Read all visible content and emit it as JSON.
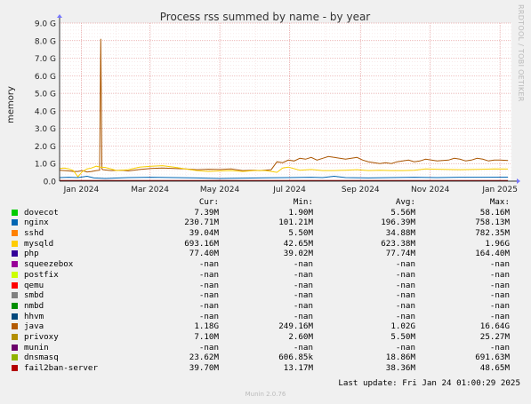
{
  "chart_data": {
    "type": "line",
    "title": "Process rss summed by name - by year",
    "ylabel": "memory",
    "xlabel": "",
    "side_label": "RRDTOOL / TOBI OETIKER",
    "yticks": [
      "0.0",
      "1.0 G",
      "2.0 G",
      "3.0 G",
      "4.0 G",
      "5.0 G",
      "6.0 G",
      "7.0 G",
      "8.0 G",
      "9.0 G"
    ],
    "ylim": [
      0,
      9.0
    ],
    "xticks": [
      "Jan 2024",
      "Mar 2024",
      "May 2024",
      "Jul 2024",
      "Sep 2024",
      "Nov 2024",
      "Jan 2025"
    ],
    "xtick_days": [
      19,
      79,
      140,
      201,
      263,
      324,
      385
    ],
    "xlim_days": [
      0,
      395
    ],
    "grid": true,
    "series": [
      {
        "name": "java",
        "color": "#aa5500",
        "points": [
          [
            0,
            0.62
          ],
          [
            4,
            0.6
          ],
          [
            8,
            0.58
          ],
          [
            12,
            0.55
          ],
          [
            16,
            0.55
          ],
          [
            20,
            0.6
          ],
          [
            24,
            0.52
          ],
          [
            28,
            0.55
          ],
          [
            32,
            0.6
          ],
          [
            35,
            0.62
          ],
          [
            36,
            8.1
          ],
          [
            37,
            0.7
          ],
          [
            38,
            0.65
          ],
          [
            45,
            0.6
          ],
          [
            55,
            0.62
          ],
          [
            60,
            0.58
          ],
          [
            70,
            0.66
          ],
          [
            80,
            0.72
          ],
          [
            90,
            0.75
          ],
          [
            100,
            0.72
          ],
          [
            110,
            0.7
          ],
          [
            120,
            0.65
          ],
          [
            130,
            0.68
          ],
          [
            140,
            0.66
          ],
          [
            150,
            0.7
          ],
          [
            160,
            0.6
          ],
          [
            170,
            0.62
          ],
          [
            175,
            0.6
          ],
          [
            185,
            0.65
          ],
          [
            190,
            1.1
          ],
          [
            195,
            1.05
          ],
          [
            200,
            1.2
          ],
          [
            205,
            1.15
          ],
          [
            210,
            1.3
          ],
          [
            215,
            1.25
          ],
          [
            220,
            1.35
          ],
          [
            225,
            1.2
          ],
          [
            230,
            1.3
          ],
          [
            235,
            1.4
          ],
          [
            240,
            1.35
          ],
          [
            245,
            1.3
          ],
          [
            250,
            1.25
          ],
          [
            255,
            1.3
          ],
          [
            260,
            1.35
          ],
          [
            265,
            1.2
          ],
          [
            270,
            1.1
          ],
          [
            275,
            1.05
          ],
          [
            280,
            1.0
          ],
          [
            285,
            1.05
          ],
          [
            290,
            1.0
          ],
          [
            295,
            1.1
          ],
          [
            300,
            1.15
          ],
          [
            305,
            1.2
          ],
          [
            310,
            1.1
          ],
          [
            315,
            1.15
          ],
          [
            320,
            1.25
          ],
          [
            325,
            1.2
          ],
          [
            330,
            1.15
          ],
          [
            340,
            1.2
          ],
          [
            345,
            1.3
          ],
          [
            350,
            1.25
          ],
          [
            355,
            1.15
          ],
          [
            360,
            1.2
          ],
          [
            365,
            1.3
          ],
          [
            370,
            1.25
          ],
          [
            375,
            1.15
          ],
          [
            380,
            1.2
          ],
          [
            385,
            1.2
          ],
          [
            392,
            1.18
          ]
        ]
      },
      {
        "name": "mysqld",
        "color": "#f8cd00",
        "points": [
          [
            0,
            0.72
          ],
          [
            4,
            0.75
          ],
          [
            8,
            0.7
          ],
          [
            12,
            0.6
          ],
          [
            16,
            0.25
          ],
          [
            20,
            0.55
          ],
          [
            24,
            0.7
          ],
          [
            28,
            0.75
          ],
          [
            32,
            0.85
          ],
          [
            36,
            0.8
          ],
          [
            40,
            0.78
          ],
          [
            50,
            0.6
          ],
          [
            60,
            0.65
          ],
          [
            70,
            0.8
          ],
          [
            80,
            0.85
          ],
          [
            90,
            0.88
          ],
          [
            100,
            0.8
          ],
          [
            110,
            0.7
          ],
          [
            120,
            0.6
          ],
          [
            130,
            0.55
          ],
          [
            140,
            0.58
          ],
          [
            150,
            0.6
          ],
          [
            160,
            0.55
          ],
          [
            170,
            0.6
          ],
          [
            180,
            0.6
          ],
          [
            190,
            0.5
          ],
          [
            195,
            0.75
          ],
          [
            200,
            0.8
          ],
          [
            210,
            0.62
          ],
          [
            220,
            0.66
          ],
          [
            230,
            0.6
          ],
          [
            240,
            0.6
          ],
          [
            250,
            0.62
          ],
          [
            260,
            0.65
          ],
          [
            270,
            0.6
          ],
          [
            280,
            0.62
          ],
          [
            290,
            0.6
          ],
          [
            300,
            0.6
          ],
          [
            310,
            0.62
          ],
          [
            320,
            0.7
          ],
          [
            330,
            0.68
          ],
          [
            340,
            0.66
          ],
          [
            350,
            0.65
          ],
          [
            360,
            0.66
          ],
          [
            370,
            0.68
          ],
          [
            380,
            0.7
          ],
          [
            392,
            0.69
          ]
        ]
      },
      {
        "name": "nginx",
        "color": "#0066b3",
        "points": [
          [
            0,
            0.2
          ],
          [
            8,
            0.22
          ],
          [
            16,
            0.2
          ],
          [
            24,
            0.28
          ],
          [
            30,
            0.18
          ],
          [
            40,
            0.15
          ],
          [
            60,
            0.2
          ],
          [
            80,
            0.22
          ],
          [
            100,
            0.2
          ],
          [
            120,
            0.18
          ],
          [
            140,
            0.15
          ],
          [
            160,
            0.17
          ],
          [
            180,
            0.19
          ],
          [
            200,
            0.2
          ],
          [
            220,
            0.22
          ],
          [
            230,
            0.2
          ],
          [
            240,
            0.28
          ],
          [
            250,
            0.2
          ],
          [
            270,
            0.18
          ],
          [
            290,
            0.2
          ],
          [
            310,
            0.22
          ],
          [
            330,
            0.2
          ],
          [
            350,
            0.22
          ],
          [
            370,
            0.22
          ],
          [
            392,
            0.23
          ]
        ]
      },
      {
        "name": "fail2ban-server",
        "color": "#990000",
        "points": [
          [
            0,
            0.04
          ],
          [
            100,
            0.04
          ],
          [
            200,
            0.04
          ],
          [
            300,
            0.04
          ],
          [
            392,
            0.04
          ]
        ]
      }
    ]
  },
  "legend": {
    "headers": {
      "cur": "Cur:",
      "min": "Min:",
      "avg": "Avg:",
      "max": "Max:"
    },
    "rows": [
      {
        "name": "dovecot",
        "color": "#00cc00",
        "cur": "7.39M",
        "min": "1.90M",
        "avg": "5.56M",
        "max": "58.16M"
      },
      {
        "name": "nginx",
        "color": "#0066b3",
        "cur": "230.71M",
        "min": "101.21M",
        "avg": "196.39M",
        "max": "758.13M"
      },
      {
        "name": "sshd",
        "color": "#ff8000",
        "cur": "39.04M",
        "min": "5.50M",
        "avg": "34.88M",
        "max": "782.35M"
      },
      {
        "name": "mysqld",
        "color": "#ffcc00",
        "cur": "693.16M",
        "min": "42.65M",
        "avg": "623.38M",
        "max": "1.96G"
      },
      {
        "name": "php",
        "color": "#330099",
        "cur": "77.40M",
        "min": "39.02M",
        "avg": "77.74M",
        "max": "164.40M"
      },
      {
        "name": "squeezebox",
        "color": "#990099",
        "cur": "-nan",
        "min": "-nan",
        "avg": "-nan",
        "max": "-nan"
      },
      {
        "name": "postfix",
        "color": "#ccff00",
        "cur": "-nan",
        "min": "-nan",
        "avg": "-nan",
        "max": "-nan"
      },
      {
        "name": "qemu",
        "color": "#ff0000",
        "cur": "-nan",
        "min": "-nan",
        "avg": "-nan",
        "max": "-nan"
      },
      {
        "name": "smbd",
        "color": "#808080",
        "cur": "-nan",
        "min": "-nan",
        "avg": "-nan",
        "max": "-nan"
      },
      {
        "name": "nmbd",
        "color": "#008f00",
        "cur": "-nan",
        "min": "-nan",
        "avg": "-nan",
        "max": "-nan"
      },
      {
        "name": "hhvm",
        "color": "#00487d",
        "cur": "-nan",
        "min": "-nan",
        "avg": "-nan",
        "max": "-nan"
      },
      {
        "name": "java",
        "color": "#b35a00",
        "cur": "1.18G",
        "min": "249.16M",
        "avg": "1.02G",
        "max": "16.64G"
      },
      {
        "name": "privoxy",
        "color": "#b38f00",
        "cur": "7.10M",
        "min": "2.60M",
        "avg": "5.50M",
        "max": "25.27M"
      },
      {
        "name": "munin",
        "color": "#6b006b",
        "cur": "-nan",
        "min": "-nan",
        "avg": "-nan",
        "max": "-nan"
      },
      {
        "name": "dnsmasq",
        "color": "#8fb300",
        "cur": "23.62M",
        "min": "606.85k",
        "avg": "18.86M",
        "max": "691.63M"
      },
      {
        "name": "fail2ban-server",
        "color": "#b30000",
        "cur": "39.70M",
        "min": "13.17M",
        "avg": "38.36M",
        "max": "48.65M"
      }
    ]
  },
  "footer": {
    "last_update": "Last update: Fri Jan 24 01:00:29 2025",
    "version": "Munin 2.0.76"
  }
}
